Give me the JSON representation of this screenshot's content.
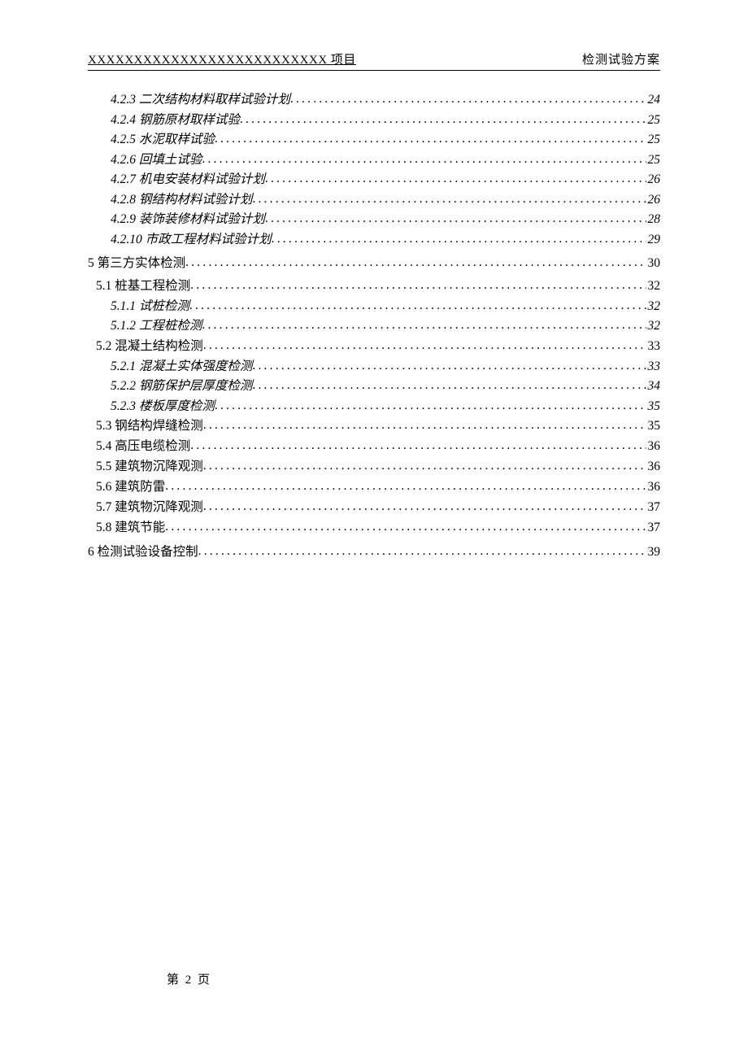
{
  "header": {
    "left": "XXXXXXXXXXXXXXXXXXXXXXXXXX 项目",
    "right": "检测试验方案"
  },
  "toc": [
    {
      "level": 3,
      "label": "4.2.3 二次结构材料取样试验计划",
      "page": "24"
    },
    {
      "level": 3,
      "label": "4.2.4 钢筋原材取样试验",
      "page": "25"
    },
    {
      "level": 3,
      "label": "4.2.5 水泥取样试验",
      "page": "25"
    },
    {
      "level": 3,
      "label": "4.2.6 回填土试验",
      "page": "25"
    },
    {
      "level": 3,
      "label": "4.2.7 机电安装材料试验计划",
      "page": "26"
    },
    {
      "level": 3,
      "label": "4.2.8 钢结构材料试验计划",
      "page": "26"
    },
    {
      "level": 3,
      "label": "4.2.9 装饰装修材料试验计划",
      "page": "28"
    },
    {
      "level": 3,
      "label": "4.2.10 市政工程材料试验计划",
      "page": "29"
    },
    {
      "level": 1,
      "label": "5 第三方实体检测",
      "page": "30"
    },
    {
      "level": 2,
      "label": "5.1 桩基工程检测 ",
      "page": "32"
    },
    {
      "level": 3,
      "label": "5.1.1 试桩检测",
      "page": "32"
    },
    {
      "level": 3,
      "label": "5.1.2 工程桩检测",
      "page": "32"
    },
    {
      "level": 2,
      "label": "5.2 混凝土结构检测 ",
      "page": "33"
    },
    {
      "level": 3,
      "label": "5.2.1 混凝土实体强度检测",
      "page": "33"
    },
    {
      "level": 3,
      "label": "5.2.2 钢筋保护层厚度检测",
      "page": "34"
    },
    {
      "level": 3,
      "label": "5.2.3 楼板厚度检测",
      "page": "35"
    },
    {
      "level": 2,
      "label": "5.3 钢结构焊缝检测 ",
      "page": "35"
    },
    {
      "level": 2,
      "label": "5.4 高压电缆检测 ",
      "page": "36"
    },
    {
      "level": 2,
      "label": "5.5 建筑物沉降观测 ",
      "page": "36"
    },
    {
      "level": 2,
      "label": "5.6 建筑防雷 ",
      "page": "36"
    },
    {
      "level": 2,
      "label": "5.7 建筑物沉降观测 ",
      "page": "37"
    },
    {
      "level": 2,
      "label": "5.8 建筑节能 ",
      "page": "37"
    },
    {
      "level": 1,
      "label": "6 检测试验设备控制",
      "page": "39"
    }
  ],
  "footer": "第 2 页"
}
